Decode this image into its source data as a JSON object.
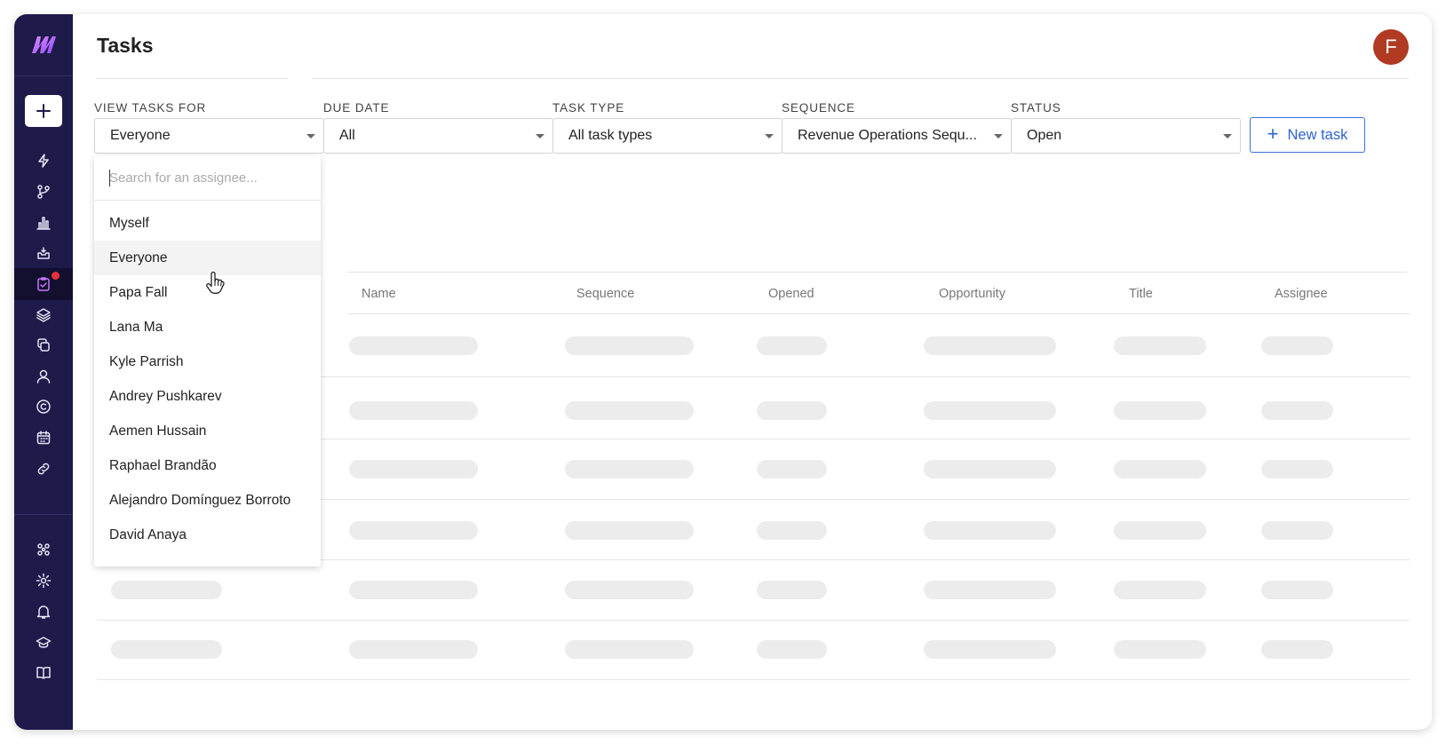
{
  "page": {
    "title": "Tasks",
    "avatar_initial": "F"
  },
  "colors": {
    "sidebar": "#1e1a4a",
    "accent": "#2e63cf",
    "avatar": "#b03a22",
    "badge": "#e8303a",
    "active_icon": "#c878ff"
  },
  "sidebar": {
    "logo_icon": "m-logo-icon",
    "create_icon": "plus-icon",
    "items": [
      {
        "icon": "lightning-icon"
      },
      {
        "icon": "branch-icon"
      },
      {
        "icon": "bar-chart-icon"
      },
      {
        "icon": "inbox-icon"
      },
      {
        "icon": "task-clipboard-icon",
        "active": true,
        "badge": true
      },
      {
        "icon": "layers-icon"
      },
      {
        "icon": "copy-icon"
      },
      {
        "icon": "person-icon"
      },
      {
        "icon": "copyright-icon"
      },
      {
        "icon": "calendar-icon"
      },
      {
        "icon": "link-icon"
      }
    ],
    "bottom_items": [
      {
        "icon": "integrations-icon"
      },
      {
        "icon": "gear-icon"
      },
      {
        "icon": "bell-icon"
      },
      {
        "icon": "graduation-cap-icon"
      },
      {
        "icon": "book-icon"
      }
    ]
  },
  "filters": [
    {
      "label": "VIEW TASKS FOR",
      "value": "Everyone"
    },
    {
      "label": "DUE DATE",
      "value": "All"
    },
    {
      "label": "TASK TYPE",
      "value": "All task types"
    },
    {
      "label": "SEQUENCE",
      "value": "Revenue Operations Sequ..."
    },
    {
      "label": "STATUS",
      "value": "Open"
    }
  ],
  "new_task": {
    "label": "New task",
    "icon": "plus-icon"
  },
  "table": {
    "columns": [
      "Name",
      "Sequence",
      "Opened",
      "Opportunity",
      "Title",
      "Assignee"
    ]
  },
  "assignee_dropdown": {
    "placeholder": "Search for an assignee...",
    "options": [
      "Myself",
      "Everyone",
      "Papa Fall",
      "Lana Ma",
      "Kyle Parrish",
      "Andrey Pushkarev",
      "Aemen Hussain",
      "Raphael Brandão",
      "Alejandro Domínguez Borroto",
      "David Anaya"
    ],
    "hovered": "Everyone"
  }
}
